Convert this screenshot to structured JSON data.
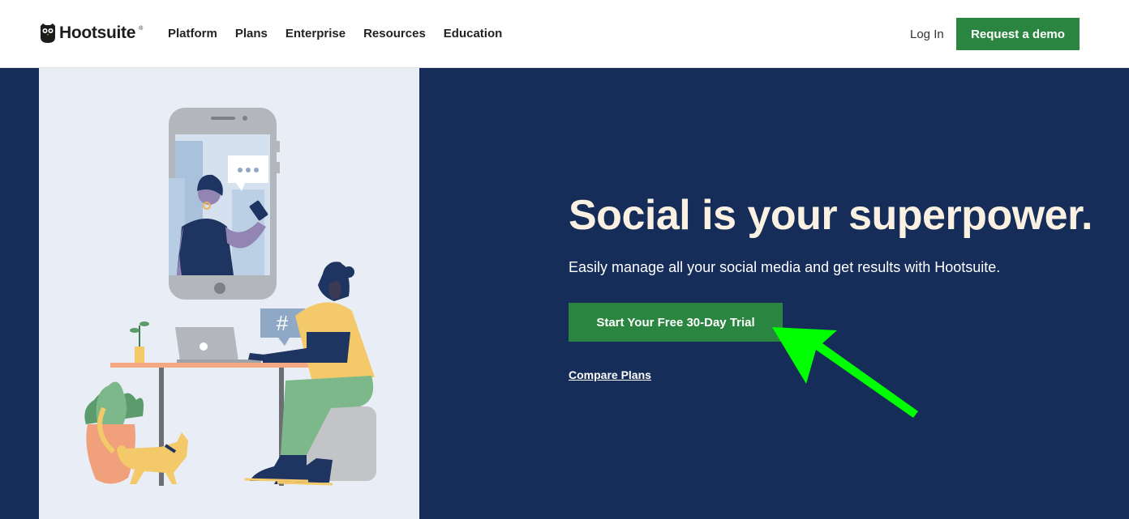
{
  "header": {
    "logo_text": "Hootsuite",
    "logo_mark": "®",
    "nav": [
      "Platform",
      "Plans",
      "Enterprise",
      "Resources",
      "Education"
    ],
    "login_label": "Log In",
    "demo_label": "Request a demo"
  },
  "hero": {
    "headline": "Social is your superpower.",
    "subtext": "Easily manage all your social media and get results with Hootsuite.",
    "cta_label": "Start Your Free 30-Day Trial",
    "compare_label": "Compare Plans",
    "illustration_hashtag": "#"
  },
  "colors": {
    "brand_green": "#2a8540",
    "hero_navy": "#152d58",
    "headline_cream": "#fbf1e2",
    "annotation_arrow": "#00ff00"
  },
  "icons": [
    "owl-logo-icon",
    "green-pointer-arrow"
  ]
}
